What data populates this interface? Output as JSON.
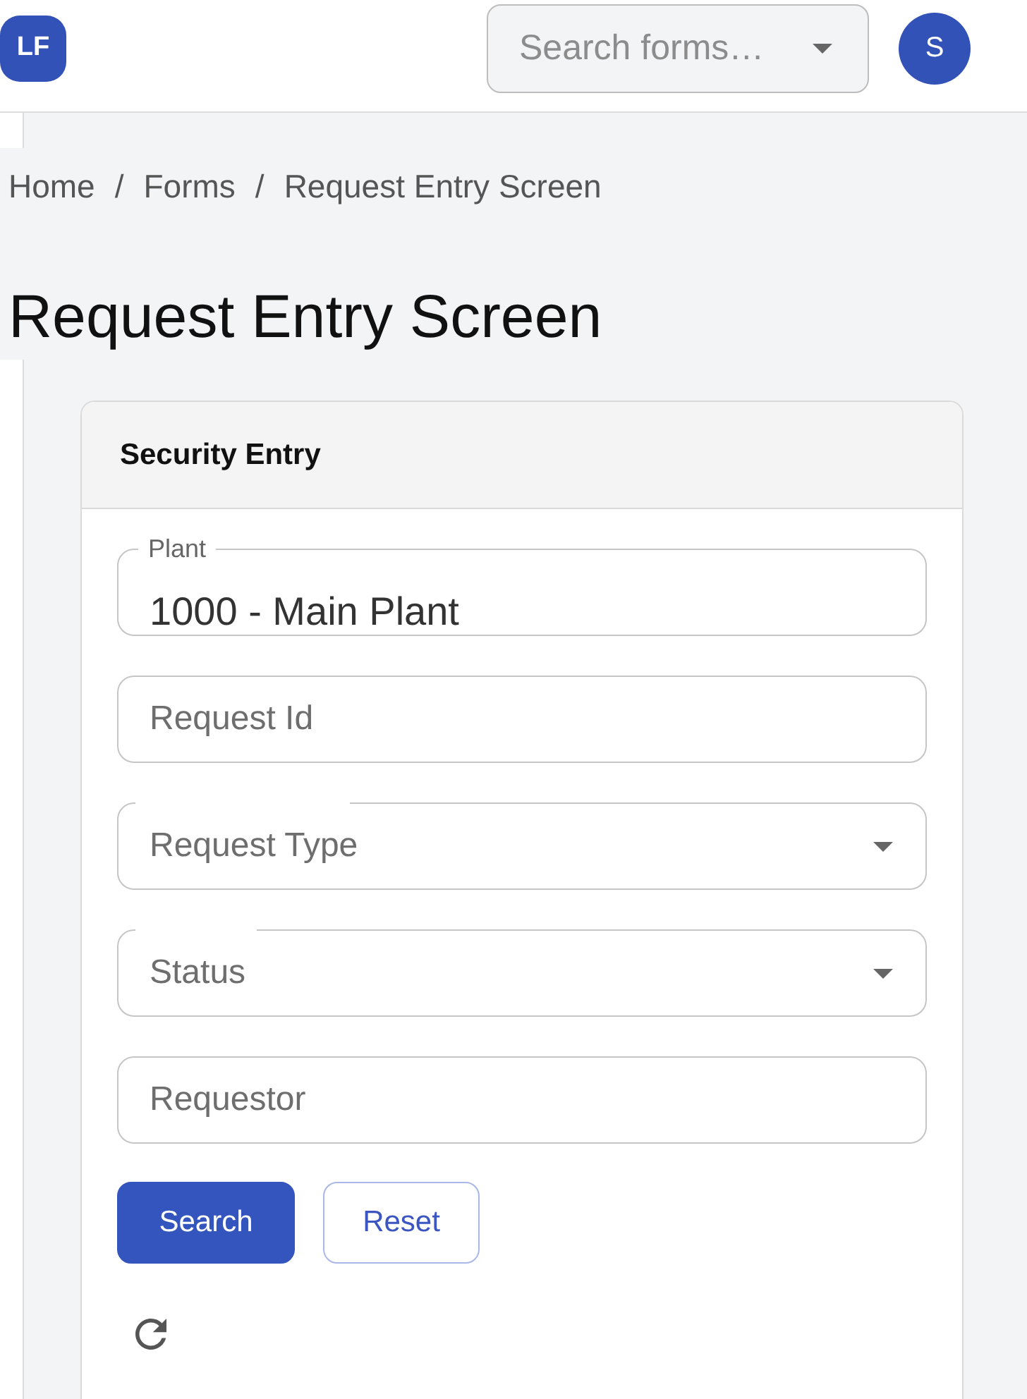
{
  "topbar": {
    "logo": "LF",
    "search": {
      "placeholder": "Search forms…"
    },
    "avatar": "S"
  },
  "breadcrumb": {
    "items": [
      "Home",
      "Forms",
      "Request Entry Screen"
    ],
    "separators": [
      "/",
      "/"
    ]
  },
  "page_title": "Request Entry Screen",
  "card": {
    "title": "Security Entry",
    "fields": [
      {
        "kind": "text",
        "label": "Plant",
        "value": "1000 - Main Plant"
      },
      {
        "kind": "text",
        "placeholder": "Request Id"
      },
      {
        "kind": "select",
        "placeholder": "Request Type"
      },
      {
        "kind": "select",
        "placeholder": "Status"
      },
      {
        "kind": "text",
        "placeholder": "Requestor"
      }
    ],
    "buttons": [
      {
        "kind": "primary",
        "label": "Search"
      },
      {
        "kind": "outline",
        "label": "Reset"
      }
    ]
  }
}
